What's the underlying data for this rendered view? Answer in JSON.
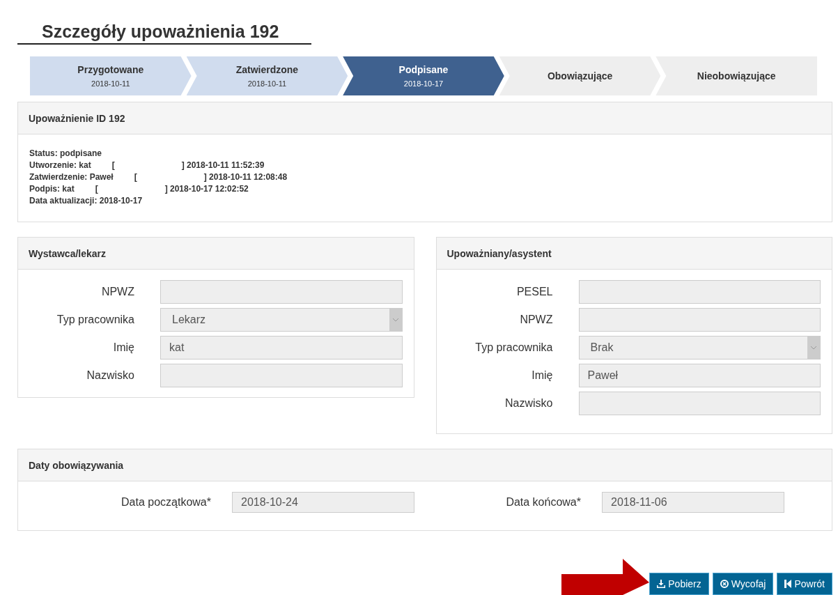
{
  "title": "Szczegóły upoważnienia 192",
  "steps": [
    {
      "label": "Przygotowane",
      "date": "2018-10-11",
      "done": true,
      "selected": false
    },
    {
      "label": "Zatwierdzone",
      "date": "2018-10-11",
      "done": true,
      "selected": false
    },
    {
      "label": "Podpisane",
      "date": "2018-10-17",
      "done": false,
      "selected": true
    },
    {
      "label": "Obowiązujące",
      "done": false,
      "selected": false
    },
    {
      "label": "Nieobowiązujące",
      "done": false,
      "selected": false
    }
  ],
  "info": {
    "heading": "Upoważnienie ID 192",
    "lines": [
      {
        "text": "Status: podpisane"
      },
      {
        "text": "Utworzenie: kat",
        "open": "[",
        "close": "] 2018-10-11 11:52:39"
      },
      {
        "text": "Zatwierdzenie: Paweł",
        "open": "[",
        "close": "] 2018-10-11 12:08:48"
      },
      {
        "text": "Podpis: kat",
        "open": "[",
        "close": "] 2018-10-17 12:02:52"
      },
      {
        "text": "Data aktualizacji: 2018-10-17"
      }
    ]
  },
  "issuer": {
    "heading": "Wystawca/lekarz",
    "fields": [
      {
        "label": "NPWZ",
        "kind": "text"
      },
      {
        "label": "Typ pracownika",
        "kind": "select",
        "value": "Lekarz"
      },
      {
        "label": "Imię",
        "kind": "text",
        "value": "kat"
      },
      {
        "label": "Nazwisko",
        "kind": "text"
      }
    ]
  },
  "assistant": {
    "heading": "Upoważniany/asystent",
    "fields": [
      {
        "label": "PESEL",
        "kind": "text"
      },
      {
        "label": "NPWZ",
        "kind": "text"
      },
      {
        "label": "Typ pracownika",
        "kind": "select",
        "value": "Brak"
      },
      {
        "label": "Imię",
        "kind": "text",
        "value": "Paweł"
      },
      {
        "label": "Nazwisko",
        "kind": "text"
      }
    ]
  },
  "validity": {
    "heading": "Daty obowiązywania",
    "fields": [
      {
        "label": "Data początkowa*",
        "value": "2018-10-24"
      },
      {
        "label": "Data końcowa*",
        "value": "2018-11-06"
      }
    ]
  },
  "buttons": [
    {
      "label": "Pobierz",
      "kind": "download"
    },
    {
      "label": "Wycofaj",
      "kind": "cancel"
    },
    {
      "label": "Powrót",
      "kind": "back"
    }
  ]
}
